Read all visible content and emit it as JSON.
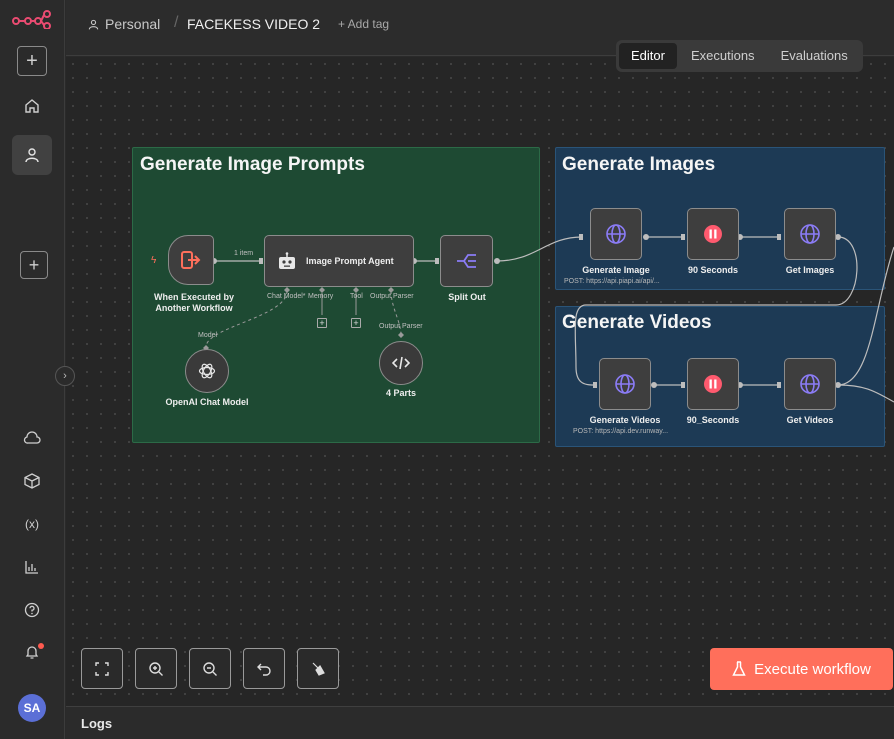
{
  "sidebar": {
    "logo": "n8n-logo-icon",
    "collapse_glyph": "›",
    "avatar_initials": "SA",
    "icons": [
      "plus-icon",
      "home-icon",
      "user-icon",
      "plus-icon",
      "cloud-icon",
      "box-icon",
      "variables-icon",
      "chart-icon",
      "help-icon",
      "bell-icon"
    ]
  },
  "header": {
    "personal": "Personal",
    "title": "FACEKESS VIDEO 2",
    "add_tag": "+ Add tag",
    "tabs": [
      {
        "label": "Editor",
        "active": true
      },
      {
        "label": "Executions",
        "active": false
      },
      {
        "label": "Evaluations",
        "active": false
      }
    ]
  },
  "groups": {
    "prompts": "Generate Image Prompts",
    "images": "Generate Images",
    "videos": "Generate Videos"
  },
  "nodes": {
    "trigger": {
      "label_line1": "When Executed by",
      "label_line2": "Another Workflow"
    },
    "item_count": "1 item",
    "agent": {
      "label": "Image Prompt Agent",
      "chat_model": "Chat Model*",
      "memory": "Memory",
      "tool": "Tool",
      "output_parser": "Output Parser"
    },
    "split": {
      "label": "Split Out"
    },
    "openai": {
      "label": "OpenAI Chat Model",
      "port": "Model"
    },
    "parts": {
      "label": "4 Parts",
      "port": "Output Parser"
    },
    "gen_image": {
      "label": "Generate Image",
      "sub": "POST: https://api.piapi.ai/api/..."
    },
    "wait1": {
      "label": "90 Seconds"
    },
    "get_images": {
      "label": "Get Images"
    },
    "gen_videos": {
      "label": "Generate Videos",
      "sub": "POST: https://api.dev.runway..."
    },
    "wait2": {
      "label": "90_Seconds"
    },
    "get_videos": {
      "label": "Get Videos"
    }
  },
  "toolbar": {
    "execute_label": "Execute workflow",
    "buttons": [
      "fit-view-icon",
      "zoom-in-icon",
      "zoom-out-icon",
      "undo-icon",
      "clear-icon"
    ]
  },
  "logs": {
    "label": "Logs"
  },
  "colors": {
    "accent": "#ff6f5b",
    "green_group": "#1e4a33",
    "blue_group": "#1d3a55",
    "avatar": "#5b6fd6"
  }
}
